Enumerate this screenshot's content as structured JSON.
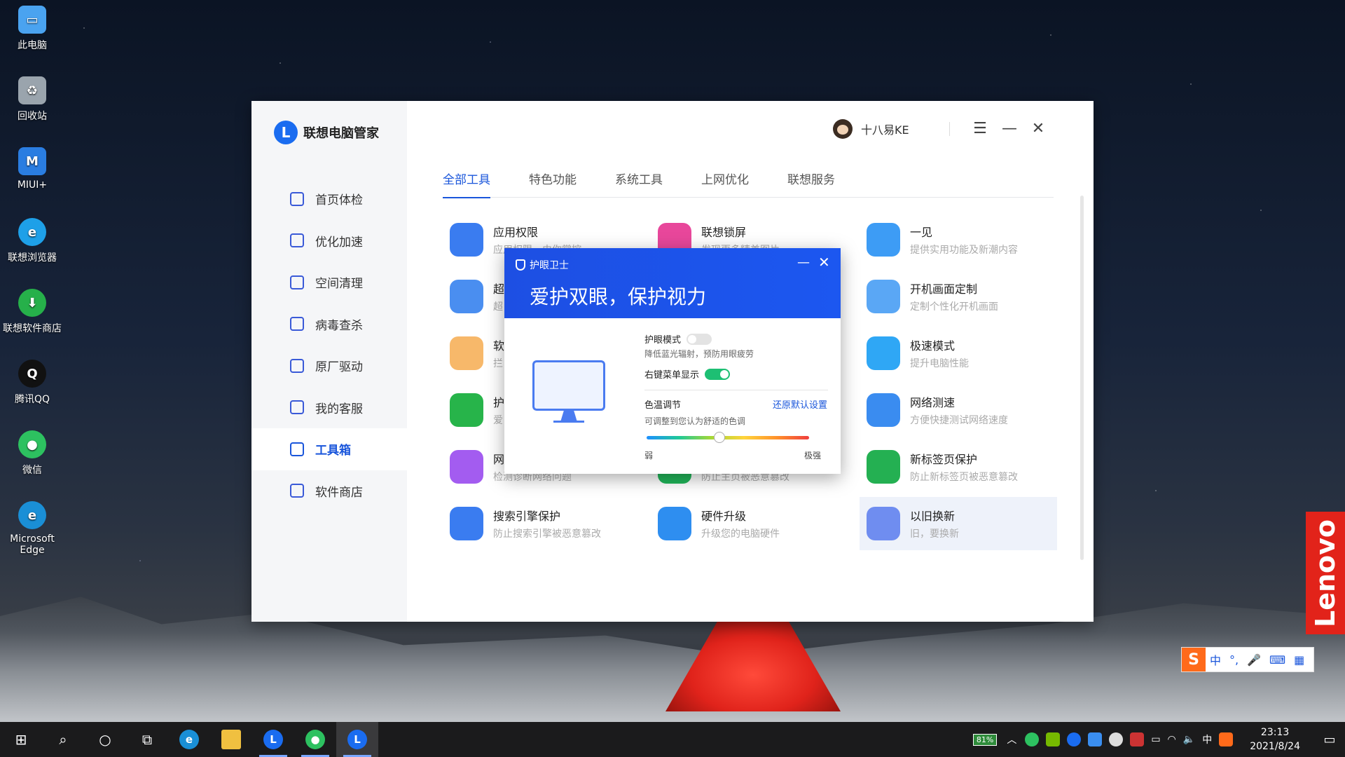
{
  "desktop": {
    "icons": [
      {
        "label": "此电脑",
        "color": "#4aa3f0"
      },
      {
        "label": "回收站",
        "color": "#9aa4ad"
      },
      {
        "label": "MIUI+",
        "color": "#2a7de1"
      },
      {
        "label": "联想浏览器",
        "color": "#1ea0e8"
      },
      {
        "label": "联想软件商店",
        "color": "#26b04a"
      },
      {
        "label": "腾讯QQ",
        "color": "#111111"
      },
      {
        "label": "微信",
        "color": "#2dc160"
      },
      {
        "label": "Microsoft Edge",
        "color": "#1a8fd6"
      }
    ]
  },
  "app": {
    "brand": "联想电脑管家",
    "user_name": "十八易KE",
    "nav": [
      "首页体检",
      "优化加速",
      "空间清理",
      "病毒查杀",
      "原厂驱动",
      "我的客服",
      "工具箱",
      "软件商店"
    ],
    "active_nav": 6,
    "tabs": [
      "全部工具",
      "特色功能",
      "系统工具",
      "上网优化",
      "联想服务"
    ],
    "active_tab": 0,
    "tools": [
      {
        "name": "应用权限",
        "desc": "应用权限，由你掌控",
        "icon": "lock-icon",
        "color": "#3a7cf0"
      },
      {
        "name": "联想锁屏",
        "desc": "发现更多精美图片",
        "icon": "flower-icon",
        "color": "#e8479b"
      },
      {
        "name": "一见",
        "desc": "提供实用功能及新潮内容",
        "icon": "chat-bubble-icon",
        "color": "#3d9cf5"
      },
      {
        "name": "超",
        "desc": "超",
        "icon": "hd-icon",
        "color": "#4a8ef0"
      },
      {
        "name": "",
        "desc": "",
        "icon": "",
        "color": "#ffffff"
      },
      {
        "name": "开机画面定制",
        "desc": "定制个性化开机画面",
        "icon": "monitor-custom-icon",
        "color": "#5aa7f5"
      },
      {
        "name": "软",
        "desc": "拦",
        "icon": "window-icon",
        "color": "#f7b86a"
      },
      {
        "name": "",
        "desc": "",
        "icon": "",
        "color": "#ffffff"
      },
      {
        "name": "极速模式",
        "desc": "提升电脑性能",
        "icon": "lightning-icon",
        "color": "#2fa7f5"
      },
      {
        "name": "护",
        "desc": "爱",
        "icon": "eye-shield-icon",
        "color": "#27b44a"
      },
      {
        "name": "",
        "desc": "",
        "icon": "",
        "color": "#ffffff"
      },
      {
        "name": "网络测速",
        "desc": "方便快捷测试网络速度",
        "icon": "bar-chart-icon",
        "color": "#3a8cf0"
      },
      {
        "name": "网络诊断",
        "desc": "检测诊断网络问题",
        "icon": "signal-icon",
        "color": "#a35cf0"
      },
      {
        "name": "浏览器保护",
        "desc": "防止主页被恶意篡改",
        "icon": "browser-shield-icon",
        "color": "#21b65a"
      },
      {
        "name": "新标签页保护",
        "desc": "防止新标签页被恶意篡改",
        "icon": "bookmark-icon",
        "color": "#24b052"
      },
      {
        "name": "搜索引擎保护",
        "desc": "防止搜索引擎被恶意篡改",
        "icon": "search-shield-icon",
        "color": "#3a7cf0"
      },
      {
        "name": "硬件升级",
        "desc": "升级您的电脑硬件",
        "icon": "memory-icon",
        "color": "#2e8ef0"
      },
      {
        "name": "以旧换新",
        "desc": "旧，要换新",
        "icon": "laptop-icon",
        "color": "#6f8df0"
      }
    ]
  },
  "popup": {
    "title": "护眼卫士",
    "slogan": "爱护双眼，保护视力",
    "eye_mode_label": "护眼模式",
    "eye_mode_on": false,
    "eye_mode_desc": "降低蓝光辐射，预防用眼疲劳",
    "context_menu_label": "右键菜单显示",
    "context_menu_on": true,
    "color_temp_label": "色温调节",
    "reset_label": "还原默认设置",
    "color_temp_desc": "可调整到您认为舒适的色调",
    "color_temp_level": 0.45,
    "weak_label": "弱",
    "strong_label": "极强"
  },
  "lenovo_tag": "Lenovo",
  "ime": {
    "logo": "S",
    "items": [
      "中",
      "°,",
      "🎤",
      "⌨",
      "▦"
    ]
  },
  "taskbar": {
    "battery": "81%",
    "ime_lang": "中",
    "time": "23:13",
    "date": "2021/8/24"
  }
}
